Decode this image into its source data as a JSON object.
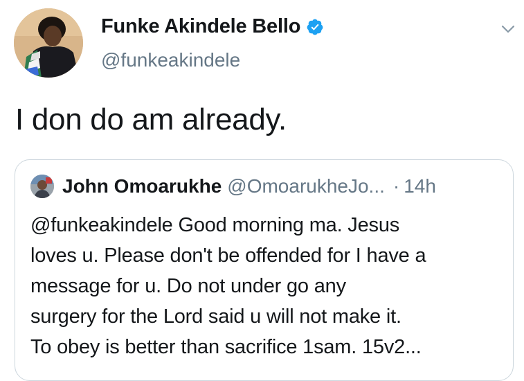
{
  "tweet": {
    "author": {
      "name": "Funke Akindele Bello",
      "handle": "@funkeakindele",
      "verified": true,
      "avatar_icon": "profile-avatar"
    },
    "text": "I don do am already.",
    "menu_icon": "chevron-down-icon"
  },
  "quoted_tweet": {
    "author": {
      "name": "John Omoarukhe",
      "handle": "@OmoarukheJo...",
      "avatar_icon": "profile-avatar"
    },
    "separator": "·",
    "time": "14h",
    "text_lines": [
      "@funkeakindele  Good morning ma. Jesus",
      "loves u. Please don't be offended for I have a",
      "message for u.   Do not under go any",
      "surgery for the Lord said u will not make it.",
      "To obey is better than sacrifice 1sam. 15v2..."
    ]
  },
  "colors": {
    "text": "#14171a",
    "secondary": "#657786",
    "verified": "#1da1f2",
    "border": "#ccd6dd"
  }
}
